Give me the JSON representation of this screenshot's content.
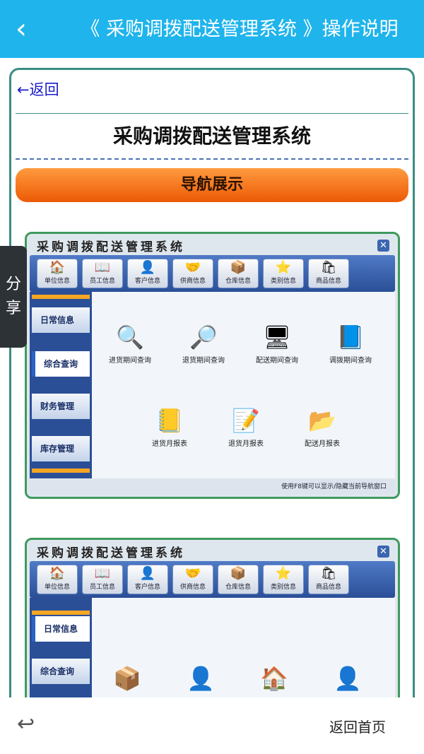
{
  "header": {
    "back_icon": "chevron-left-icon",
    "title": "《 采购调拨配送管理系统 》操作说明"
  },
  "content": {
    "back_link": "←返回",
    "page_title": "采购调拨配送管理系统",
    "nav_button": "导航展示"
  },
  "app_window": {
    "title": "采购调拨配送管理系统",
    "close_glyph": "✕",
    "toolbar": [
      "单位信息",
      "员工信息",
      "客户信息",
      "供商信息",
      "仓库信息",
      "类别信息",
      "商品信息"
    ],
    "sidebar": [
      "日常信息",
      "综合查询",
      "财务管理",
      "库存管理"
    ],
    "query_functions": [
      "进货期间查询",
      "退货期间查询",
      "配送期间查询",
      "调拨期间查询"
    ],
    "report_functions": [
      "进货月报表",
      "退货月报表",
      "配送月报表"
    ],
    "status_text": "使用F8键可以显示/隐藏当前导航窗口"
  },
  "app_window_2": {
    "title": "采购调拨配送管理系统",
    "close_glyph": "✕",
    "toolbar": [
      "单位信息",
      "员工信息",
      "客户信息",
      "供商信息",
      "仓库信息",
      "类别信息",
      "商品信息"
    ],
    "sidebar": [
      "日常信息",
      "综合查询"
    ]
  },
  "share": {
    "label": "分享"
  },
  "footer": {
    "undo_icon": "undo-arrow-icon",
    "home_label": "返回首页"
  }
}
